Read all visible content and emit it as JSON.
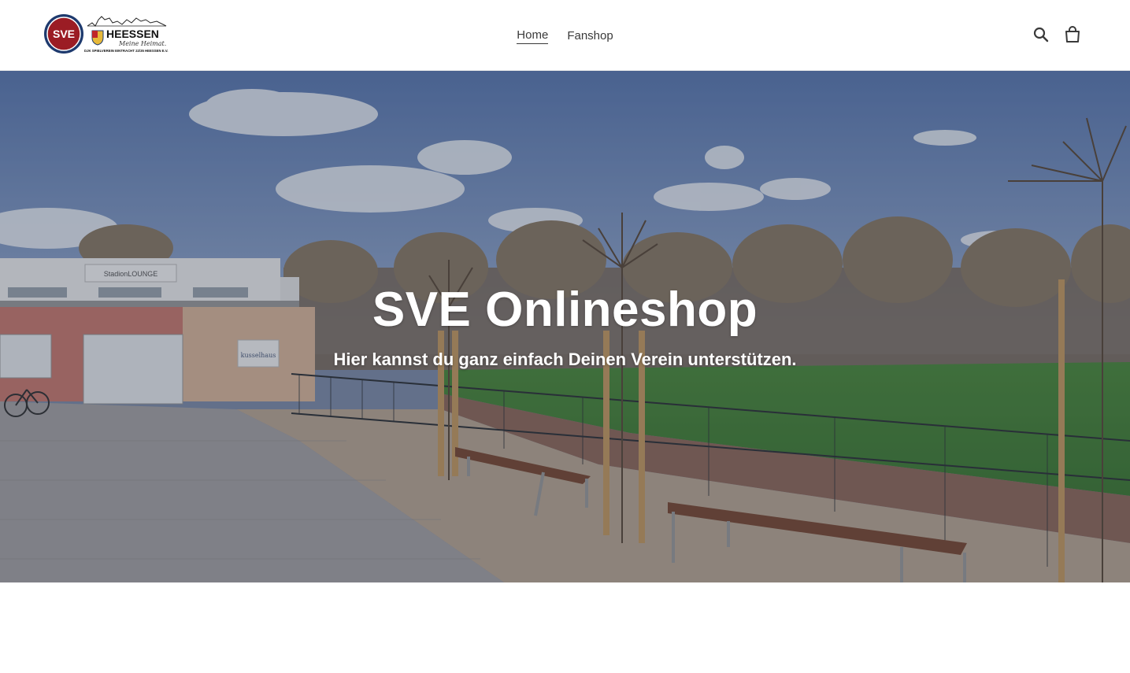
{
  "header": {
    "logo": {
      "badge_text": "SVE",
      "brand_text": "HEESSEN",
      "tagline": "Meine Heimat.",
      "club_name": "DJK SPIELVEREIN EINTRACHT 22/35 HEESSEN E.V.",
      "badge_color": "#9b1c24",
      "ring_color": "#1e3a6e"
    },
    "nav": [
      {
        "label": "Home",
        "active": true
      },
      {
        "label": "Fanshop",
        "active": false
      }
    ],
    "icons": {
      "search": "search-icon",
      "cart": "cart-icon"
    }
  },
  "hero": {
    "title": "SVE Onlineshop",
    "subtitle": "Hier kannst du ganz einfach Deinen Verein unterstützen.",
    "building_sign": "StadionLOUNGE",
    "sponsor_sign": "kusselhaus"
  },
  "colors": {
    "text": "#3a3a3a",
    "header_bg": "#ffffff",
    "sky": "#6f86b3",
    "grass": "#4e7a3a",
    "building_wall": "#c87a70"
  }
}
